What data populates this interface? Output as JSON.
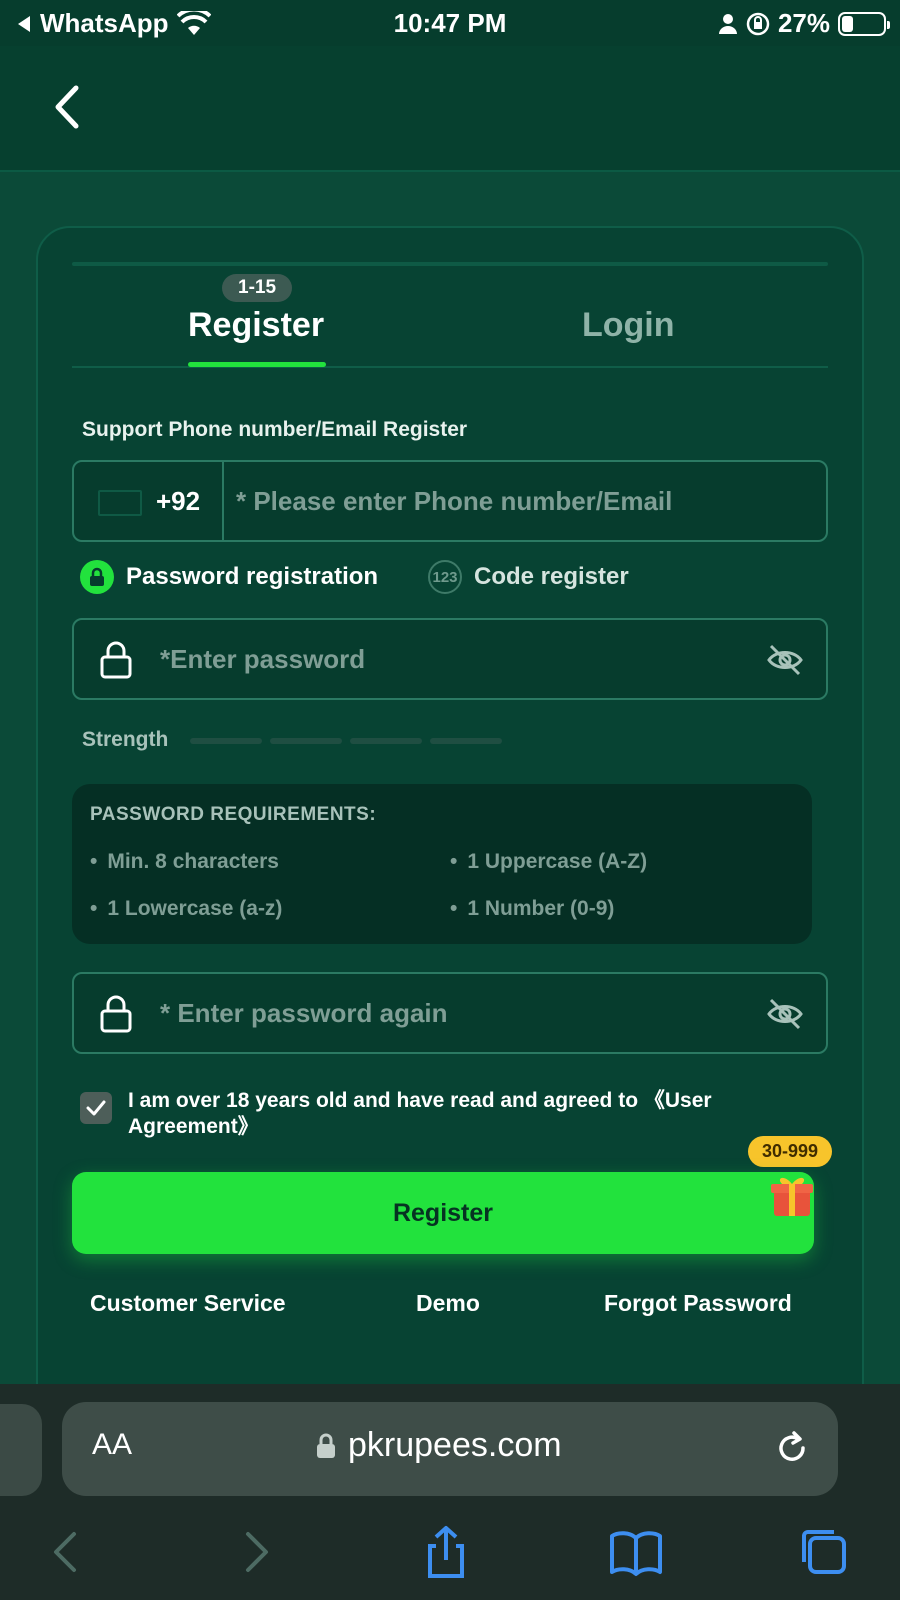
{
  "status_bar": {
    "back_app": "WhatsApp",
    "time": "10:47 PM",
    "battery": "27%",
    "battery_level": 0.27
  },
  "tabs": {
    "register": "Register",
    "login": "Login",
    "register_badge": "1-15"
  },
  "form": {
    "support_label": "Support Phone number/Email Register",
    "country_code": "+92",
    "phone_placeholder": "* Please enter Phone number/Email",
    "mode_password": "Password registration",
    "mode_code": "Code register",
    "mode_code_icon": "123",
    "password_placeholder": "*Enter password",
    "strength_label": "Strength",
    "requirements_title": "PASSWORD REQUIREMENTS:",
    "requirements": [
      "Min. 8 characters",
      "1 Uppercase (A-Z)",
      "1 Lowercase (a-z)",
      "1 Number (0-9)"
    ],
    "password_again_placeholder": "* Enter password again",
    "agreement": "I am over 18 years old and have read and agreed to 《User Agreement》",
    "agreement_checked": true,
    "register_button": "Register",
    "bonus_badge": "30-999"
  },
  "footer": {
    "customer_service": "Customer Service",
    "demo": "Demo",
    "forgot_password": "Forgot Password"
  },
  "browser": {
    "text_size": "AA",
    "url": "pkrupees.com"
  },
  "colors": {
    "accent_green": "#22e23d",
    "background": "#0b4a38",
    "badge_yellow": "#f7c42b"
  },
  "icons": [
    "back-chevron-icon",
    "lock-icon",
    "eye-off-icon",
    "gift-icon",
    "reload-icon",
    "share-icon",
    "bookmarks-icon",
    "tabs-icon"
  ]
}
